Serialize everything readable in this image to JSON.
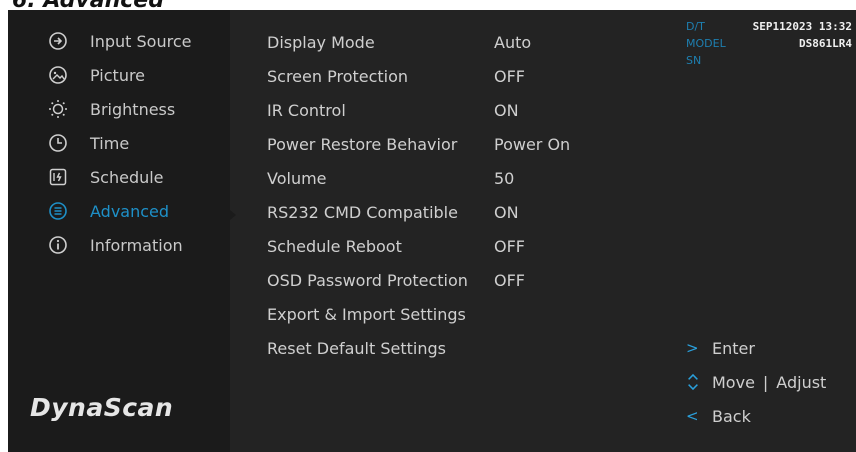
{
  "page_heading": "6. Advanced",
  "brand": {
    "logo_text": "DynaScan"
  },
  "sidebar": {
    "items": [
      {
        "label": "Input Source",
        "icon": "input-source-icon"
      },
      {
        "label": "Picture",
        "icon": "picture-icon"
      },
      {
        "label": "Brightness",
        "icon": "brightness-icon"
      },
      {
        "label": "Time",
        "icon": "clock-icon"
      },
      {
        "label": "Schedule",
        "icon": "schedule-icon"
      },
      {
        "label": "Advanced",
        "icon": "advanced-icon",
        "active": true
      },
      {
        "label": "Information",
        "icon": "information-icon"
      }
    ]
  },
  "settings": [
    {
      "label": "Display Mode",
      "value": "Auto"
    },
    {
      "label": "Screen Protection",
      "value": "OFF"
    },
    {
      "label": "IR Control",
      "value": "ON"
    },
    {
      "label": "Power Restore Behavior",
      "value": "Power On"
    },
    {
      "label": "Volume",
      "value": "50"
    },
    {
      "label": "RS232 CMD Compatible",
      "value": "ON"
    },
    {
      "label": "Schedule Reboot",
      "value": "OFF"
    },
    {
      "label": "OSD Password Protection",
      "value": "OFF"
    },
    {
      "label": "Export & Import Settings",
      "value": ""
    },
    {
      "label": "Reset Default Settings",
      "value": ""
    }
  ],
  "device_info": {
    "dt_label": "D/T",
    "dt_value": "SEP112023 13:32",
    "model_label": "MODEL",
    "model_value": "DS861LR4",
    "sn_label": "SN",
    "sn_value": ""
  },
  "hints": {
    "enter": {
      "icon": "chevron-right-icon",
      "label": "Enter"
    },
    "move": {
      "icon": "up-down-icon",
      "label": "Move",
      "separator": "|",
      "label2": "Adjust"
    },
    "back": {
      "icon": "chevron-left-icon",
      "label": "Back"
    }
  },
  "colors": {
    "accent": "#1e90c8",
    "panel": "#232323",
    "sidebar": "#1b1b1b",
    "text": "#cfcfcf"
  }
}
